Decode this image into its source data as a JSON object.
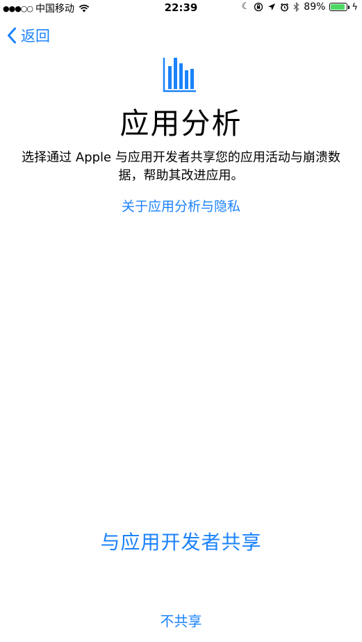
{
  "status_bar": {
    "signal": "●●●○○",
    "carrier": "中国移动",
    "time": "22:39",
    "battery_percent": "89%",
    "battery_level": 0.89,
    "icons": [
      "moon-icon",
      "orientation-lock-icon",
      "location-icon",
      "alarm-icon",
      "bluetooth-icon",
      "charging-icon"
    ]
  },
  "nav": {
    "back_label": "返回"
  },
  "header": {
    "icon": "bar-chart-icon",
    "title": "应用分析",
    "description": "选择通过 Apple 与应用开发者共享您的应用活动与崩溃数据，帮助其改进应用。",
    "privacy_link": "关于应用分析与隐私"
  },
  "actions": {
    "share_label": "与应用开发者共享",
    "dont_share_label": "不共享"
  },
  "colors": {
    "accent": "#1a82fb",
    "battery": "#4cd964"
  }
}
